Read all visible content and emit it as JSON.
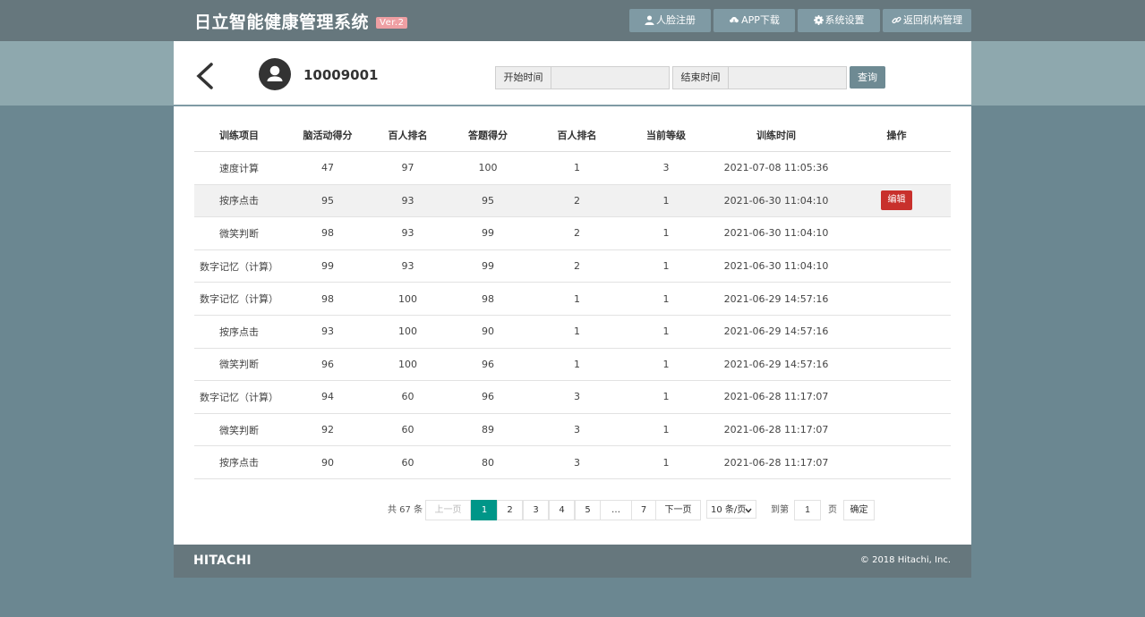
{
  "header": {
    "title": "日立智能健康管理系统",
    "version": "Ver.2",
    "nav": [
      {
        "label": "人脸注册",
        "icon": "user-icon"
      },
      {
        "label": "APP下载",
        "icon": "cloud-download-icon"
      },
      {
        "label": "系统设置",
        "icon": "gear-icon"
      },
      {
        "label": "返回机构管理",
        "icon": "link-icon"
      }
    ]
  },
  "toolbar": {
    "user_id": "10009001",
    "start_label": "开始时间",
    "start_value": "",
    "end_label": "结束时间",
    "end_value": "",
    "query_label": "查询"
  },
  "table": {
    "columns": [
      "训练项目",
      "脑活动得分",
      "百人排名",
      "答题得分",
      "百人排名",
      "当前等级",
      "训练时间",
      "操作"
    ],
    "edit_label": "编辑",
    "rows": [
      [
        "速度计算",
        "47",
        "97",
        "100",
        "1",
        "3",
        "2021-07-08 11:05:36",
        ""
      ],
      [
        "按序点击",
        "95",
        "93",
        "95",
        "2",
        "1",
        "2021-06-30 11:04:10",
        "编辑"
      ],
      [
        "微笑判断",
        "98",
        "93",
        "99",
        "2",
        "1",
        "2021-06-30 11:04:10",
        ""
      ],
      [
        "数字记忆（计算）",
        "99",
        "93",
        "99",
        "2",
        "1",
        "2021-06-30 11:04:10",
        ""
      ],
      [
        "数字记忆（计算）",
        "98",
        "100",
        "98",
        "1",
        "1",
        "2021-06-29 14:57:16",
        ""
      ],
      [
        "按序点击",
        "93",
        "100",
        "90",
        "1",
        "1",
        "2021-06-29 14:57:16",
        ""
      ],
      [
        "微笑判断",
        "96",
        "100",
        "96",
        "1",
        "1",
        "2021-06-29 14:57:16",
        ""
      ],
      [
        "数字记忆（计算）",
        "94",
        "60",
        "96",
        "3",
        "1",
        "2021-06-28 11:17:07",
        ""
      ],
      [
        "微笑判断",
        "92",
        "60",
        "89",
        "3",
        "1",
        "2021-06-28 11:17:07",
        ""
      ],
      [
        "按序点击",
        "90",
        "60",
        "80",
        "3",
        "1",
        "2021-06-28 11:17:07",
        ""
      ]
    ]
  },
  "pagination": {
    "total": "共 67 条",
    "prev": "上一页",
    "pages": [
      "1",
      "2",
      "3",
      "4",
      "5",
      "…",
      "7"
    ],
    "current": "1",
    "next": "下一页",
    "page_size": "10 条/页",
    "goto_label": "到第",
    "goto_value": "1",
    "page_unit": "页",
    "confirm": "确定"
  },
  "footer": {
    "logo": "HITACHI",
    "copyright": "© 2018 Hitachi, Inc."
  },
  "colors": {
    "accent": "#009688",
    "danger": "#c8302c",
    "bar": "#66777d"
  }
}
